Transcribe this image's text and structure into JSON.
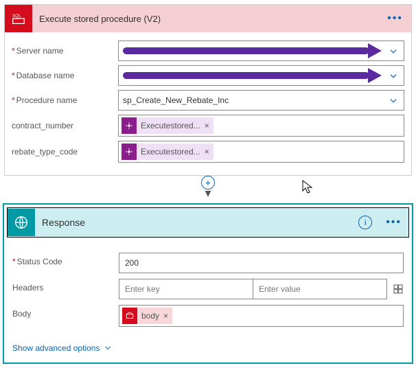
{
  "card1": {
    "title": "Execute stored procedure (V2)",
    "fields": {
      "serverName": {
        "label": "Server name",
        "required": true,
        "value": ""
      },
      "databaseName": {
        "label": "Database name",
        "required": true,
        "value": ""
      },
      "procedureName": {
        "label": "Procedure name",
        "required": true,
        "value": "sp_Create_New_Rebate_Inc"
      },
      "contractNumber": {
        "label": "contract_number",
        "token": "Executestored..."
      },
      "rebateTypeCode": {
        "label": "rebate_type_code",
        "token": "Executestored..."
      }
    }
  },
  "card2": {
    "title": "Response",
    "fields": {
      "statusCode": {
        "label": "Status Code",
        "required": true,
        "value": "200"
      },
      "headers": {
        "label": "Headers",
        "keyPlaceholder": "Enter key",
        "valuePlaceholder": "Enter value"
      },
      "body": {
        "label": "Body",
        "token": "body"
      }
    },
    "advanced": "Show advanced options"
  }
}
